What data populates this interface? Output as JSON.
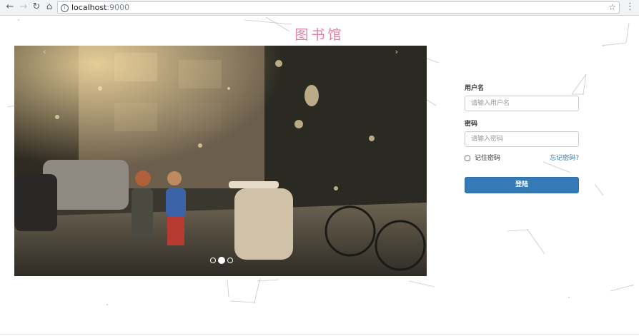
{
  "browser": {
    "url_host": "localhost",
    "url_port": ":9000",
    "back_icon": "arrow-left-icon",
    "forward_icon": "arrow-right-icon",
    "reload_icon": "reload-icon",
    "home_icon": "home-icon",
    "info_icon": "info-icon",
    "bookmark_icon": "star-icon",
    "menu_icon": "kebab-menu-icon"
  },
  "page": {
    "title": "图书馆"
  },
  "carousel": {
    "prev_label": "‹",
    "next_label": "›",
    "slide_count": 3,
    "active_index": 1
  },
  "login": {
    "username_label": "用户名",
    "username_placeholder": "请输入用户名",
    "username_value": "",
    "password_label": "密码",
    "password_placeholder": "请输入密码",
    "password_value": "",
    "remember_label": "记住密码",
    "remember_checked": false,
    "forgot_label": "忘记密码?",
    "submit_label": "登陆"
  },
  "colors": {
    "title": "#e57fa2",
    "primary": "#337ab7",
    "link": "#337ab7"
  }
}
